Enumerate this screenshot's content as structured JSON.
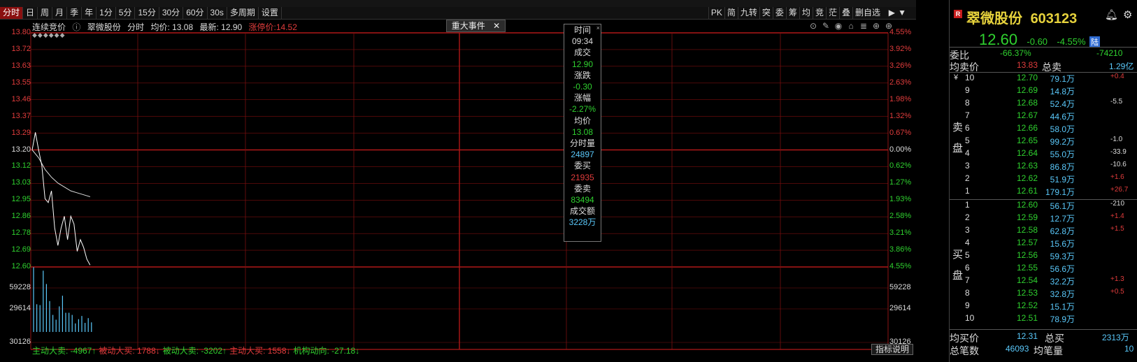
{
  "toolbar": {
    "periods": [
      "分时",
      "日",
      "周",
      "月",
      "季",
      "年",
      "1分",
      "5分",
      "15分",
      "30分",
      "60分",
      "30s",
      "多周期",
      "设置"
    ],
    "active_period": "分时",
    "tools": [
      "PK",
      "简",
      "九转",
      "突",
      "委",
      "筹",
      "均",
      "竞",
      "茫",
      "叠",
      "删自选"
    ]
  },
  "info": {
    "auction": "连续竞价",
    "stock_name": "翠微股份",
    "mode": "分时",
    "avg": "均价: 13.08",
    "latest": "最新: 12.90",
    "limit_up": "涨停价:14.52"
  },
  "event_tab": {
    "label": "重大事件",
    "close": "✕"
  },
  "price_axis": {
    "left": [
      "13.80",
      "13.72",
      "13.63",
      "13.55",
      "13.46",
      "13.37",
      "13.29",
      "13.20",
      "13.12",
      "13.03",
      "12.95",
      "12.86",
      "12.78",
      "12.69",
      "12.60"
    ],
    "right": [
      "4.55%",
      "3.92%",
      "3.26%",
      "2.63%",
      "1.98%",
      "1.32%",
      "0.67%",
      "0.00%",
      "0.62%",
      "1.27%",
      "1.93%",
      "2.58%",
      "3.21%",
      "3.86%",
      "4.55%"
    ]
  },
  "volume_axis": {
    "left": [
      "59228",
      "29614",
      "30126"
    ],
    "right": [
      "59228",
      "29614",
      "30126"
    ]
  },
  "tooltip": {
    "items": [
      {
        "label": "时间",
        "value": "09:34",
        "tone": "white"
      },
      {
        "label": "成交",
        "value": "12.90",
        "tone": "green"
      },
      {
        "label": "涨跌",
        "value": "-0.30",
        "tone": "green"
      },
      {
        "label": "涨幅",
        "value": "-2.27%",
        "tone": "green"
      },
      {
        "label": "均价",
        "value": "13.08",
        "tone": "green"
      },
      {
        "label": "分时量",
        "value": "24897",
        "tone": "cyan"
      },
      {
        "label": "委买",
        "value": "21935",
        "tone": "red"
      },
      {
        "label": "委卖",
        "value": "83494",
        "tone": "green"
      },
      {
        "label": "成交额",
        "value": "3228万",
        "tone": "cyan"
      }
    ]
  },
  "flow": [
    {
      "text": "主动大卖: -4967↑",
      "tone": "green"
    },
    {
      "text": "被动大买: 1788↓",
      "tone": "red"
    },
    {
      "text": "被动大卖: -3202↑",
      "tone": "green"
    },
    {
      "text": "主动大买: 1558↓",
      "tone": "red"
    },
    {
      "text": "机构动向: -27.18↓",
      "tone": "green"
    }
  ],
  "indicator_button": "指标说明",
  "panel": {
    "logo": "R",
    "name": "翠微股份",
    "code": "603123",
    "price": "12.60",
    "change": "-0.60",
    "change_pct": "-4.55%",
    "market_tag": "陆",
    "weibi_label": "委比",
    "weibi_value": "-66.37%",
    "weicha_value": "-74210",
    "avg_sell_label": "均卖价",
    "avg_sell_value": "13.83",
    "total_sell_label": "总卖",
    "total_sell_value": "1.29亿",
    "sell_side_label": [
      "卖",
      "盘"
    ],
    "buy_side_label": [
      "买",
      "盘"
    ],
    "sells": [
      {
        "lvl": "10",
        "price": "12.70",
        "vol": "79.1万",
        "chg": "+0.4"
      },
      {
        "lvl": "9",
        "price": "12.69",
        "vol": "14.8万",
        "chg": ""
      },
      {
        "lvl": "8",
        "price": "12.68",
        "vol": "52.4万",
        "chg": "-5.5"
      },
      {
        "lvl": "7",
        "price": "12.67",
        "vol": "44.6万",
        "chg": ""
      },
      {
        "lvl": "6",
        "price": "12.66",
        "vol": "58.0万",
        "chg": ""
      },
      {
        "lvl": "5",
        "price": "12.65",
        "vol": "99.2万",
        "chg": "-1.0"
      },
      {
        "lvl": "4",
        "price": "12.64",
        "vol": "55.0万",
        "chg": "-33.9"
      },
      {
        "lvl": "3",
        "price": "12.63",
        "vol": "86.8万",
        "chg": "-10.6"
      },
      {
        "lvl": "2",
        "price": "12.62",
        "vol": "51.9万",
        "chg": "+1.6"
      },
      {
        "lvl": "1",
        "price": "12.61",
        "vol": "179.1万",
        "chg": "+26.7"
      }
    ],
    "buys": [
      {
        "lvl": "1",
        "price": "12.60",
        "vol": "56.1万",
        "chg": "-210"
      },
      {
        "lvl": "2",
        "price": "12.59",
        "vol": "12.7万",
        "chg": "+1.4"
      },
      {
        "lvl": "3",
        "price": "12.58",
        "vol": "62.8万",
        "chg": "+1.5"
      },
      {
        "lvl": "4",
        "price": "12.57",
        "vol": "15.6万",
        "chg": ""
      },
      {
        "lvl": "5",
        "price": "12.56",
        "vol": "59.3万",
        "chg": ""
      },
      {
        "lvl": "6",
        "price": "12.55",
        "vol": "56.6万",
        "chg": ""
      },
      {
        "lvl": "7",
        "price": "12.54",
        "vol": "32.2万",
        "chg": "+1.3"
      },
      {
        "lvl": "8",
        "price": "12.53",
        "vol": "32.8万",
        "chg": "+0.5"
      },
      {
        "lvl": "9",
        "price": "12.52",
        "vol": "15.1万",
        "chg": ""
      },
      {
        "lvl": "10",
        "price": "12.51",
        "vol": "78.9万",
        "chg": ""
      }
    ],
    "avg_buy_label": "均买价",
    "avg_buy_value": "12.31",
    "total_buy_label": "总买",
    "total_buy_value": "2313万",
    "total_trades_label": "总笔数",
    "total_trades_value": "46093",
    "avg_trade_label": "均笔量",
    "avg_trade_value": "10"
  },
  "colors": {
    "up": "#e03c3c",
    "down": "#2fd12f",
    "grid": "#7a0e0e",
    "volume": "#5ac8fa"
  },
  "chart_data": {
    "type": "line",
    "price_series": [
      {
        "t": 0,
        "p": 13.2
      },
      {
        "t": 1,
        "p": 13.29
      },
      {
        "t": 2,
        "p": 13.2
      },
      {
        "t": 3,
        "p": 13.12
      },
      {
        "t": 4,
        "p": 12.95
      },
      {
        "t": 5,
        "p": 12.93
      },
      {
        "t": 6,
        "p": 12.99
      },
      {
        "t": 7,
        "p": 12.8
      },
      {
        "t": 8,
        "p": 12.71
      },
      {
        "t": 9,
        "p": 12.8
      },
      {
        "t": 10,
        "p": 12.86
      },
      {
        "t": 11,
        "p": 12.74
      },
      {
        "t": 12,
        "p": 12.86
      },
      {
        "t": 13,
        "p": 12.82
      },
      {
        "t": 14,
        "p": 12.68
      },
      {
        "t": 15,
        "p": 12.74
      },
      {
        "t": 16,
        "p": 12.7
      },
      {
        "t": 17,
        "p": 12.64
      },
      {
        "t": 18,
        "p": 12.61
      }
    ],
    "avg_series": [
      {
        "t": 0,
        "p": 13.2
      },
      {
        "t": 2,
        "p": 13.16
      },
      {
        "t": 4,
        "p": 13.1
      },
      {
        "t": 6,
        "p": 13.06
      },
      {
        "t": 8,
        "p": 13.03
      },
      {
        "t": 10,
        "p": 13.01
      },
      {
        "t": 12,
        "p": 12.99
      },
      {
        "t": 14,
        "p": 12.98
      },
      {
        "t": 16,
        "p": 12.97
      },
      {
        "t": 18,
        "p": 12.96
      }
    ],
    "volumes": [
      60800,
      26000,
      25200,
      57500,
      45000,
      29000,
      16000,
      11500,
      24000,
      34000,
      18000,
      18000,
      16000,
      8000,
      12000,
      15000,
      8500,
      13000,
      9000
    ],
    "ylim": [
      12.6,
      13.8
    ],
    "base": 13.2
  }
}
